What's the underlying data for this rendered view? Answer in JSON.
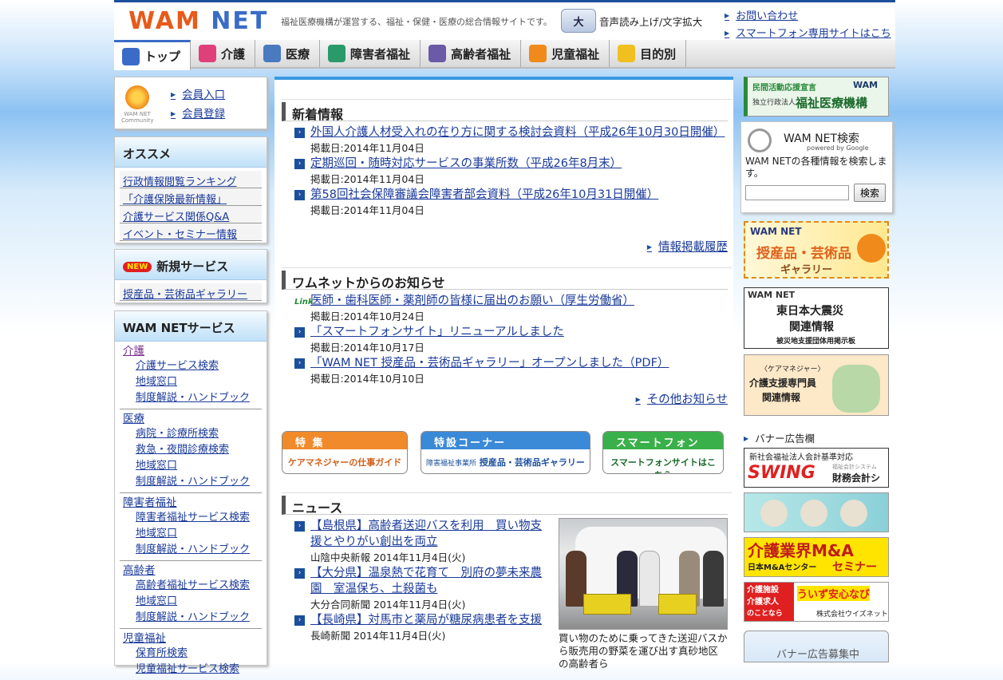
{
  "header": {
    "logo_wam": "WAM",
    "logo_net": "NET",
    "tagline": "福祉医療機構が運営する、福祉・保健・医療の総合情報サイトです。",
    "speech_icon": "大",
    "speech": "音声読み上げ/文字拡大",
    "links": [
      "お問い合わせ",
      "スマートフォン専用サイトはこちら"
    ]
  },
  "nav": {
    "tabs": [
      {
        "label": "トップ",
        "icon": "home-icon",
        "color": "#3a6bc8"
      },
      {
        "label": "介護",
        "icon": "care-icon",
        "color": "#e0407a"
      },
      {
        "label": "医療",
        "icon": "medical-icon",
        "color": "#4a7ac0"
      },
      {
        "label": "障害者福祉",
        "icon": "wheelchair-icon",
        "color": "#2a9a6a"
      },
      {
        "label": "高齢者福祉",
        "icon": "elderly-icon",
        "color": "#6a5aa8"
      },
      {
        "label": "児童福祉",
        "icon": "children-icon",
        "color": "#f08a1a"
      },
      {
        "label": "目的別",
        "icon": "question-icon",
        "color": "#f0c020"
      }
    ]
  },
  "member": {
    "logo_text": "WAM NET Community",
    "links": [
      "会員入口",
      "会員登録"
    ]
  },
  "recommend": {
    "title": "オススメ",
    "items": [
      "行政情報閲覧ランキング",
      "「介護保険最新情報」",
      "介護サービス関係Q&A",
      "イベント・セミナー情報"
    ]
  },
  "new_service": {
    "badge": "NEW",
    "title": "新規サービス",
    "items": [
      "授産品・芸術品ギャラリー"
    ]
  },
  "wam_services": {
    "title": "WAM NETサービス",
    "categories": [
      {
        "name": "介護",
        "subs": [
          "介護サービス検索",
          "地域窓口",
          "制度解説・ハンドブック"
        ]
      },
      {
        "name": "医療",
        "subs": [
          "病院・診療所検索",
          "救急・夜間診療検索",
          "地域窓口",
          "制度解説・ハンドブック"
        ]
      },
      {
        "name": "障害者福祉",
        "subs": [
          "障害者福祉サービス検索",
          "地域窓口",
          "制度解説・ハンドブック"
        ]
      },
      {
        "name": "高齢者",
        "subs": [
          "高齢者福祉サービス検索",
          "地域窓口",
          "制度解説・ハンドブック"
        ]
      },
      {
        "name": "児童福祉",
        "subs": [
          "保育所検索",
          "児童福祉サービス検索"
        ]
      }
    ]
  },
  "whats_new": {
    "title": "新着情報",
    "items": [
      {
        "text": "外国人介護人材受入れの在り方に関する検討会資料（平成26年10月30日開催）",
        "date": "掲載日:2014年11月04日"
      },
      {
        "text": "定期巡回・随時対応サービスの事業所数（平成26年8月末）",
        "date": "掲載日:2014年11月04日"
      },
      {
        "text": "第58回社会保障審議会障害者部会資料（平成26年10月31日開催）",
        "date": "掲載日:2014年11月04日"
      }
    ],
    "more": "情報掲載履歴"
  },
  "notices": {
    "title": "ワムネットからのお知らせ",
    "items": [
      {
        "text": "医師・歯科医師・薬剤師の皆様に届出のお願い（厚生労働省）",
        "date": "掲載日:2014年10月24日",
        "link": true
      },
      {
        "text": "「スマートフォンサイト」リニューアルしました",
        "date": "掲載日:2014年10月17日"
      },
      {
        "text": "「WAM NET 授産品・芸術品ギャラリー」オープンしました（PDF）",
        "date": "掲載日:2014年10月10日"
      }
    ],
    "more": "その他お知らせ",
    "link_mark": "Link"
  },
  "feature_banners": [
    {
      "top": "特 集",
      "bottom": "ケアマネジャーの仕事ガイド",
      "color": "#f08a2a"
    },
    {
      "top": "特設コーナー",
      "bottom_small": "障害福祉事業所",
      "bottom": "授産品・芸術品ギャラリー",
      "color": "#3a8ad8"
    },
    {
      "top": "スマートフォン",
      "bottom": "スマートフォンサイトはこちら",
      "color": "#3ab04a"
    }
  ],
  "news": {
    "title": "ニュース",
    "items": [
      {
        "text": "【島根県】高齢者送迎バスを利用　買い物支援とやりがい創出を両立",
        "source": "山陰中央新報 2014年11月4日(火)"
      },
      {
        "text": "【大分県】温泉熱で花育て　別府の夢未来農園　室温保ち、土殺菌も",
        "source": "大分合同新聞 2014年11月4日(火)"
      },
      {
        "text": "【長崎県】対馬市と薬局が糖尿病患者を支援",
        "source": "長崎新聞 2014年11月4日(火)"
      }
    ],
    "photo_caption": "買い物のために乗ってきた送迎バスから販売用の野菜を運び出す真砂地区の高齢者ら"
  },
  "right": {
    "top_banner_small": "民間活動応援宣言",
    "top_banner_org": "独立行政法人",
    "top_banner": "福祉医療機構",
    "top_banner_brand": "WAM",
    "search": {
      "title": "WAM NET検索",
      "powered": "powered by Google",
      "desc": "WAM NETの各種情報を検索します。",
      "button": "検索",
      "value": ""
    },
    "gallery_banner": {
      "logo": "WAM NET",
      "line1": "授産品・芸術品",
      "line2": "ギャラリー"
    },
    "quake_banner": {
      "logo": "WAM NET",
      "line1": "東日本大震災",
      "line2": "関連情報",
      "line3": "被災地支援団体用掲示板"
    },
    "caremanager_banner": {
      "small": "〈ケアマネジャー〉",
      "line1": "介護支援専門員",
      "line2": "関連情報"
    },
    "ad_head": "バナー広告欄",
    "ads": [
      {
        "small": "新社会福祉法人会計基準対応",
        "main": "SWING",
        "sub": "財務会計システム",
        "tiny": "福祉会計システム"
      },
      {
        "main": ""
      },
      {
        "main": "介護業界M&A",
        "sub": "日本M&Aセンター",
        "sub2": "セミナー"
      },
      {
        "l1": "介護施設",
        "l2": "介護求人",
        "l3": "のことなら",
        "main": "ういず安心なび",
        "sub": "株式会社ウイズネット"
      }
    ],
    "ad_recruit": "バナー広告募集中"
  }
}
